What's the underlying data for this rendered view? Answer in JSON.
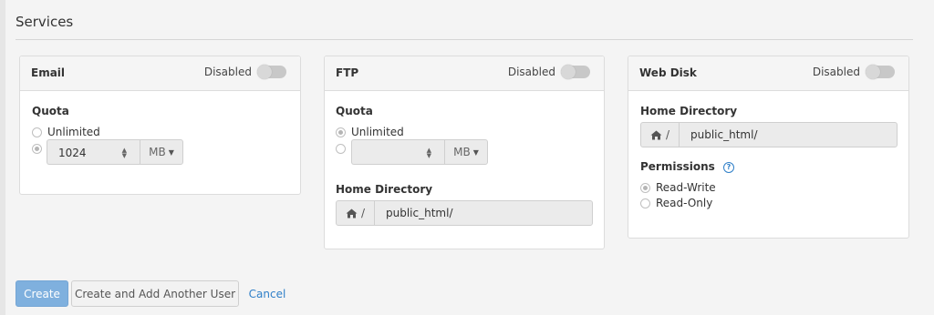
{
  "page": {
    "section_title": "Services"
  },
  "email": {
    "title": "Email",
    "toggle_label": "Disabled",
    "quota_label": "Quota",
    "unlimited_label": "Unlimited",
    "quota_value": "1024",
    "unit": "MB"
  },
  "ftp": {
    "title": "FTP",
    "toggle_label": "Disabled",
    "quota_label": "Quota",
    "unlimited_label": "Unlimited",
    "quota_value": "",
    "unit": "MB",
    "home_label": "Home Directory",
    "home_prefix": "/",
    "home_value": "public_html/"
  },
  "webdisk": {
    "title": "Web Disk",
    "toggle_label": "Disabled",
    "home_label": "Home Directory",
    "home_prefix": "/",
    "home_value": "public_html/",
    "permissions_label": "Permissions",
    "help_glyph": "?",
    "read_write": "Read-Write",
    "read_only": "Read-Only"
  },
  "actions": {
    "create": "Create",
    "create_another": "Create and Add Another User",
    "cancel": "Cancel"
  },
  "icons": {
    "home": "home-icon",
    "help": "question-circle-icon",
    "caret": "caret-down-icon"
  },
  "colors": {
    "primary": "#7fb0de",
    "link": "#2f7fc8"
  }
}
